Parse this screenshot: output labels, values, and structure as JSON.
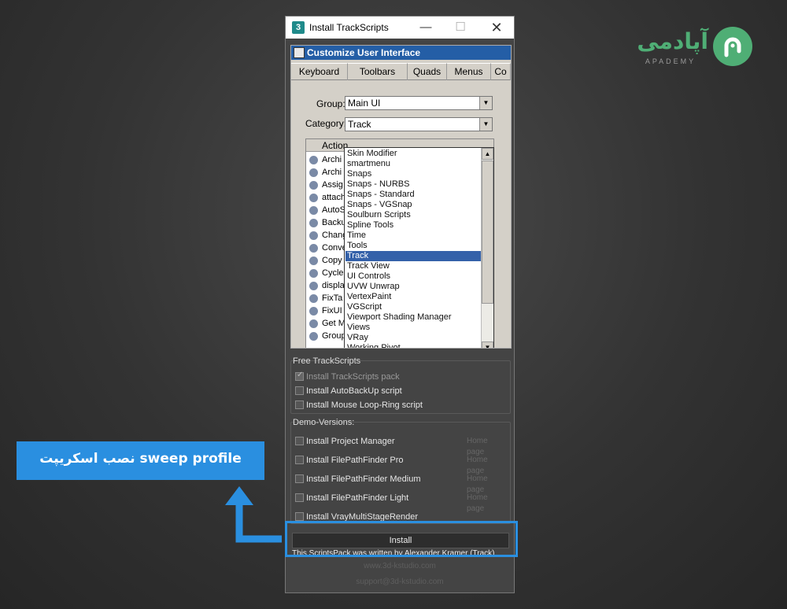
{
  "logo": {
    "text_fa": "آپادمی",
    "text_en": "APADEMY",
    "color": "#4fae75"
  },
  "window": {
    "title": "Install TrackScripts",
    "app_icon": "3",
    "minimize_glyph": "—",
    "maximize_glyph": "☐",
    "close_glyph": "✕"
  },
  "customize_ui": {
    "title": "Customize User Interface",
    "tabs": [
      "Keyboard",
      "Toolbars",
      "Quads",
      "Menus",
      "Co"
    ],
    "group_label": "Group:",
    "group_value": "Main UI",
    "category_label": "Category:",
    "category_value": "Track",
    "actions_header": "Action",
    "actions": [
      "Archi",
      "Archi",
      "Assig",
      "attach",
      "AutoS",
      "Backu",
      "Chang",
      "Conve",
      "Copy",
      "Cycle",
      "displa",
      "FixTa",
      "FixUI",
      "Get M",
      "Group"
    ],
    "category_options": [
      "Skin Modifier",
      "smartmenu",
      "Snaps",
      "Snaps - NURBS",
      "Snaps - Standard",
      "Snaps - VGSnap",
      "Soulburn Scripts",
      "Spline Tools",
      "Time",
      "Tools",
      "Track",
      "Track View",
      "UI Controls",
      "UVW Unwrap",
      "VertexPaint",
      "VGScript",
      "Viewport Shading Manager",
      "Views",
      "VRay",
      "Working Pivot"
    ],
    "selected_index": 10,
    "selection_color": "#3461a9"
  },
  "free_group": {
    "title": "Free TrackScripts",
    "items": [
      {
        "label": "Install TrackScripts pack",
        "checked": true,
        "disabled": true
      },
      {
        "label": "Install AutoBackUp script",
        "checked": false,
        "disabled": false
      },
      {
        "label": "Install Mouse Loop-Ring script",
        "checked": false,
        "disabled": false
      }
    ]
  },
  "demo_group": {
    "title": "Demo-Versions:",
    "homepage_label": "Home page",
    "items": [
      {
        "label": "Install Project Manager"
      },
      {
        "label": "Install FilePathFinder Pro"
      },
      {
        "label": "Install FilePathFinder Medium"
      },
      {
        "label": "Install FilePathFinder Light"
      },
      {
        "label": "Install VrayMultiStageRender"
      }
    ]
  },
  "install_button": "Install",
  "credit": {
    "line1": "This ScriptsPack was written by Alexander Kramer (Track)",
    "line2": "www.3d-kstudio.com",
    "line3": "support@3d-kstudio.com"
  },
  "callout": {
    "text": "نصب اسکریپت sweep profile",
    "color": "#2a8fe0"
  }
}
